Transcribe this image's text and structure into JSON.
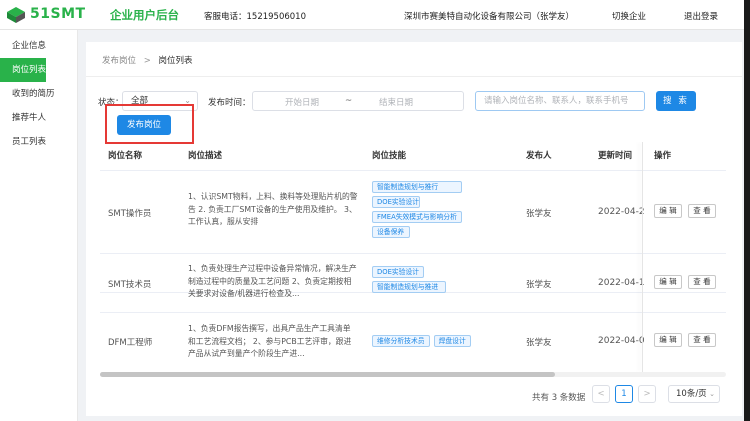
{
  "header": {
    "brand": "51SMT",
    "app_title": "企业用户后台",
    "phone": "客服电话：15219506010",
    "company": "深圳市赛美特自动化设备有限公司（张学友）",
    "switch": "切换企业",
    "logout": "退出登录"
  },
  "sidebar": {
    "items": [
      {
        "label": "企业信息"
      },
      {
        "label": "岗位列表"
      },
      {
        "label": "收到的简历"
      },
      {
        "label": "推荐牛人"
      },
      {
        "label": "员工列表"
      }
    ]
  },
  "breadcrumb": {
    "parent": "发布岗位",
    "sep": ">",
    "current": "岗位列表"
  },
  "filters": {
    "status_label": "状态：",
    "status_value": "全部",
    "time_label": "发布时间：",
    "start_placeholder": "开始日期",
    "range_sep": "~",
    "end_placeholder": "结束日期",
    "search_placeholder": "请输入岗位名称、联系人，联系手机号",
    "search_button": "搜 索",
    "publish_button": "发布岗位"
  },
  "table": {
    "columns": [
      "岗位名称",
      "岗位描述",
      "岗位技能",
      "发布人",
      "更新时间",
      "操作"
    ],
    "edit_label": "编 辑",
    "view_label": "查 看",
    "rows": [
      {
        "name": "SMT操作员",
        "desc": "1、认识SMT物料，上料、换料等处理贴片机的警告 2. 负责工厂SMT设备的生产使用及维护。 3、工作认真，服从安排",
        "skills": [
          "智能制造规划与推行",
          "DOE实验设计",
          "FMEA失效模式与影响分析",
          "设备保养"
        ],
        "publisher": "张学友",
        "updated": "2022-04-2"
      },
      {
        "name": "SMT技术员",
        "desc": "1、负责处理生产过程中设备异常情况，解决生产制造过程中的质量及工艺问题 2、负责定期按相关要求对设备/机器进行检查及...",
        "skills": [
          "DOE实验设计",
          "智能制造规划与推进"
        ],
        "publisher": "张学友",
        "updated": "2022-04-1"
      },
      {
        "name": "DFM工程师",
        "desc": "1、负责DFM报告撰写，出具产品生产工具清单和工艺流程文档； 2、参与PCB工艺评审，跟进产品从试产到量产个阶段生产进...",
        "skills": [
          "维修分析技术员",
          "焊盘设计"
        ],
        "publisher": "张学友",
        "updated": "2022-04-0"
      }
    ]
  },
  "pagination": {
    "total": "共有 3 条数据",
    "prev": "<",
    "current": "1",
    "next": ">",
    "page_size": "10条/页"
  },
  "colors": {
    "brand": "#29b24a",
    "primary": "#1e88e5",
    "highlight": "#e53935"
  }
}
